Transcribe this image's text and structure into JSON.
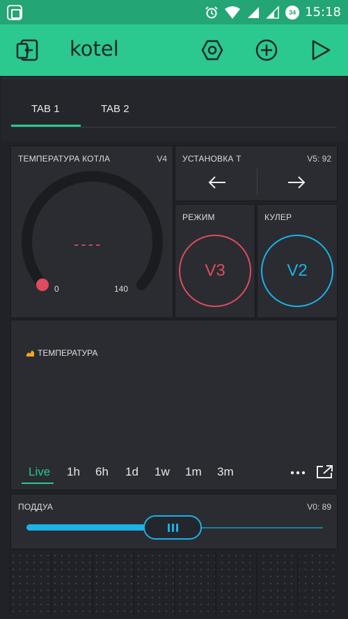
{
  "status_bar": {
    "time": "15:18",
    "battery": "34",
    "icons": [
      "app-icon",
      "alarm-icon",
      "wifi-icon",
      "signal-icon",
      "signal-icon",
      "battery-icon"
    ]
  },
  "header": {
    "title": "kotel",
    "colors": {
      "bar": "#2bc88f",
      "status": "#23a575"
    },
    "icons": [
      "exit-icon",
      "settings-hexagon-icon",
      "add-icon",
      "play-icon"
    ]
  },
  "tabs": [
    {
      "label": "TAB 1",
      "active": true
    },
    {
      "label": "TAB 2",
      "active": false
    }
  ],
  "gauge": {
    "label": "ТЕМПЕРАТУРА КОТЛА",
    "pin": "V4",
    "value": "----",
    "min": "0",
    "max": "140",
    "color": "#e04a5f"
  },
  "step": {
    "label": "УСТАНОВКА Т",
    "pin": "V5: 92",
    "icons": [
      "arrow-left-icon",
      "arrow-right-icon"
    ]
  },
  "mode_button": {
    "label": "РЕЖИМ",
    "value": "V3",
    "color": "#e04a5f"
  },
  "cooler_button": {
    "label": "КУЛЕР",
    "value": "V2",
    "color": "#1ab3e8"
  },
  "chart": {
    "legend": "ТЕМПЕРАТУРА",
    "ranges": [
      "Live",
      "1h",
      "6h",
      "1d",
      "1w",
      "1m",
      "3m"
    ],
    "active_range": "Live",
    "icons": [
      "more-icon",
      "export-icon"
    ]
  },
  "slider": {
    "label": "ПОДДУА",
    "pin": "V0: 89",
    "value_fraction": 0.5,
    "color": "#1ab3e8"
  }
}
